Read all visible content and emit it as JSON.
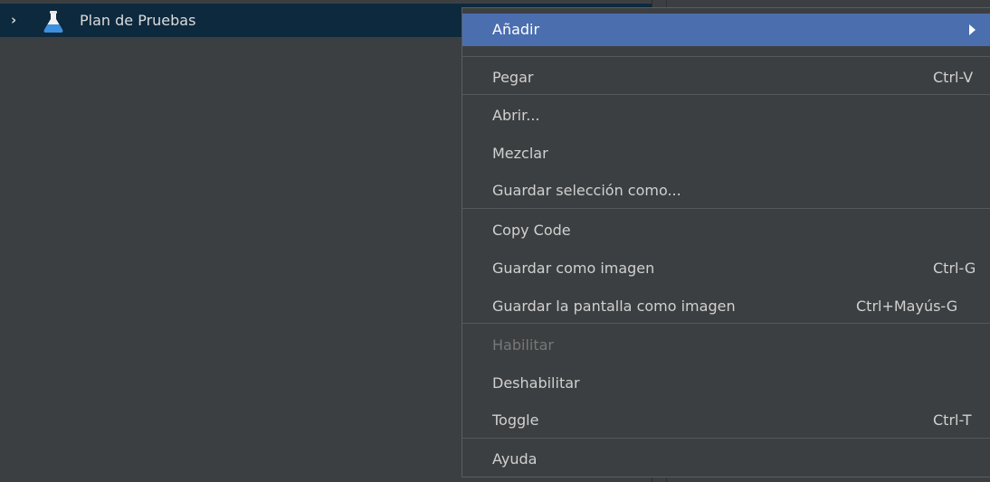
{
  "tree": {
    "expand_glyph": "›",
    "icon": "flask-icon",
    "root_label": "Plan de Pruebas"
  },
  "context_menu": {
    "items": [
      {
        "label": "Añadir",
        "shortcut": "",
        "submenu": true,
        "state": "highlighted"
      },
      {
        "label": "Pegar",
        "shortcut": "Ctrl-V"
      },
      {
        "label": "Abrir...",
        "shortcut": ""
      },
      {
        "label": "Mezclar",
        "shortcut": ""
      },
      {
        "label": "Guardar selección como...",
        "shortcut": ""
      },
      {
        "label": "Copy Code",
        "shortcut": ""
      },
      {
        "label": "Guardar como imagen",
        "shortcut": "Ctrl-G"
      },
      {
        "label": "Guardar la pantalla como imagen",
        "shortcut": "Ctrl+Mayús-G"
      },
      {
        "label": "Habilitar",
        "shortcut": "",
        "state": "disabled"
      },
      {
        "label": "Deshabilitar",
        "shortcut": ""
      },
      {
        "label": "Toggle",
        "shortcut": "Ctrl-T"
      },
      {
        "label": "Ayuda",
        "shortcut": ""
      }
    ]
  },
  "colors": {
    "background": "#3c3f41",
    "selected_row": "#0d293e",
    "menu_highlight": "#4b6eaf",
    "menu_text": "#d0d0d0",
    "disabled_text": "#777777",
    "flask_liquid": "#3d8fe0"
  }
}
